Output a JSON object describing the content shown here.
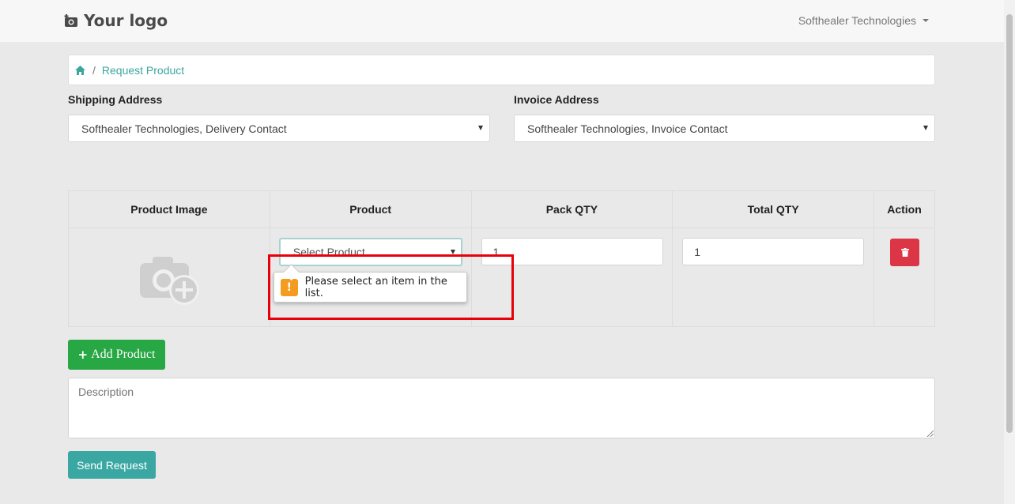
{
  "brand": {
    "logo_text": "Your logo"
  },
  "user_menu": {
    "label": "Softhealer Technologies"
  },
  "breadcrumb": {
    "current": "Request Product"
  },
  "shipping": {
    "label": "Shipping Address",
    "selected": "Softhealer Technologies, Delivery Contact"
  },
  "invoice": {
    "label": "Invoice Address",
    "selected": "Softhealer Technologies, Invoice Contact"
  },
  "table": {
    "headers": [
      "Product Image",
      "Product",
      "Pack QTY",
      "Total QTY",
      "Action"
    ],
    "row": {
      "product_placeholder": "Select Product",
      "pack_qty": "1",
      "total_qty": "1"
    }
  },
  "validation": {
    "message": "Please select an item in the list."
  },
  "buttons": {
    "add_product": "Add Product",
    "send_request": "Send Request"
  },
  "description": {
    "placeholder": "Description"
  },
  "colors": {
    "accent": "#3ba7a1",
    "success": "#28a745",
    "danger": "#dc3545",
    "warning": "#f39c1f",
    "highlight": "#e8000b"
  }
}
